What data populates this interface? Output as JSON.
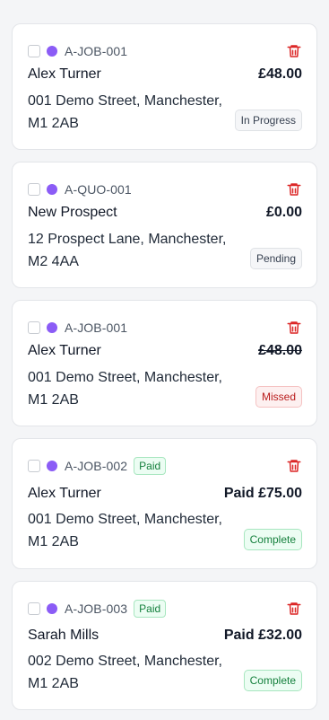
{
  "colors": {
    "dot": "#8b5cf6",
    "trash": "#dc2626",
    "paid_badge": "#15803d",
    "status_in_progress": "#374151",
    "status_pending": "#374151",
    "status_missed": "#b91c1c",
    "status_complete": "#15803d"
  },
  "icons": {
    "trash": "trash-icon",
    "dot": "status-dot"
  },
  "jobs": [
    {
      "id": "A-JOB-001",
      "paid_badge": "",
      "name": "Alex Turner",
      "amount": "£48.00",
      "amount_struck": false,
      "address": "001 Demo Street, Manchester, M1 2AB",
      "status": "In Progress"
    },
    {
      "id": "A-QUO-001",
      "paid_badge": "",
      "name": "New Prospect",
      "amount": "£0.00",
      "amount_struck": false,
      "address": "12 Prospect Lane, Manchester, M2 4AA",
      "status": "Pending"
    },
    {
      "id": "A-JOB-001",
      "paid_badge": "",
      "name": "Alex Turner",
      "amount": "£48.00",
      "amount_struck": true,
      "address": "001 Demo Street, Manchester, M1 2AB",
      "status": "Missed"
    },
    {
      "id": "A-JOB-002",
      "paid_badge": "Paid",
      "name": "Alex Turner",
      "amount": "Paid £75.00",
      "amount_struck": false,
      "address": "001 Demo Street, Manchester, M1 2AB",
      "status": "Complete"
    },
    {
      "id": "A-JOB-003",
      "paid_badge": "Paid",
      "name": "Sarah Mills",
      "amount": "Paid £32.00",
      "amount_struck": false,
      "address": "002 Demo Street, Manchester, M1 2AB",
      "status": "Complete"
    }
  ]
}
